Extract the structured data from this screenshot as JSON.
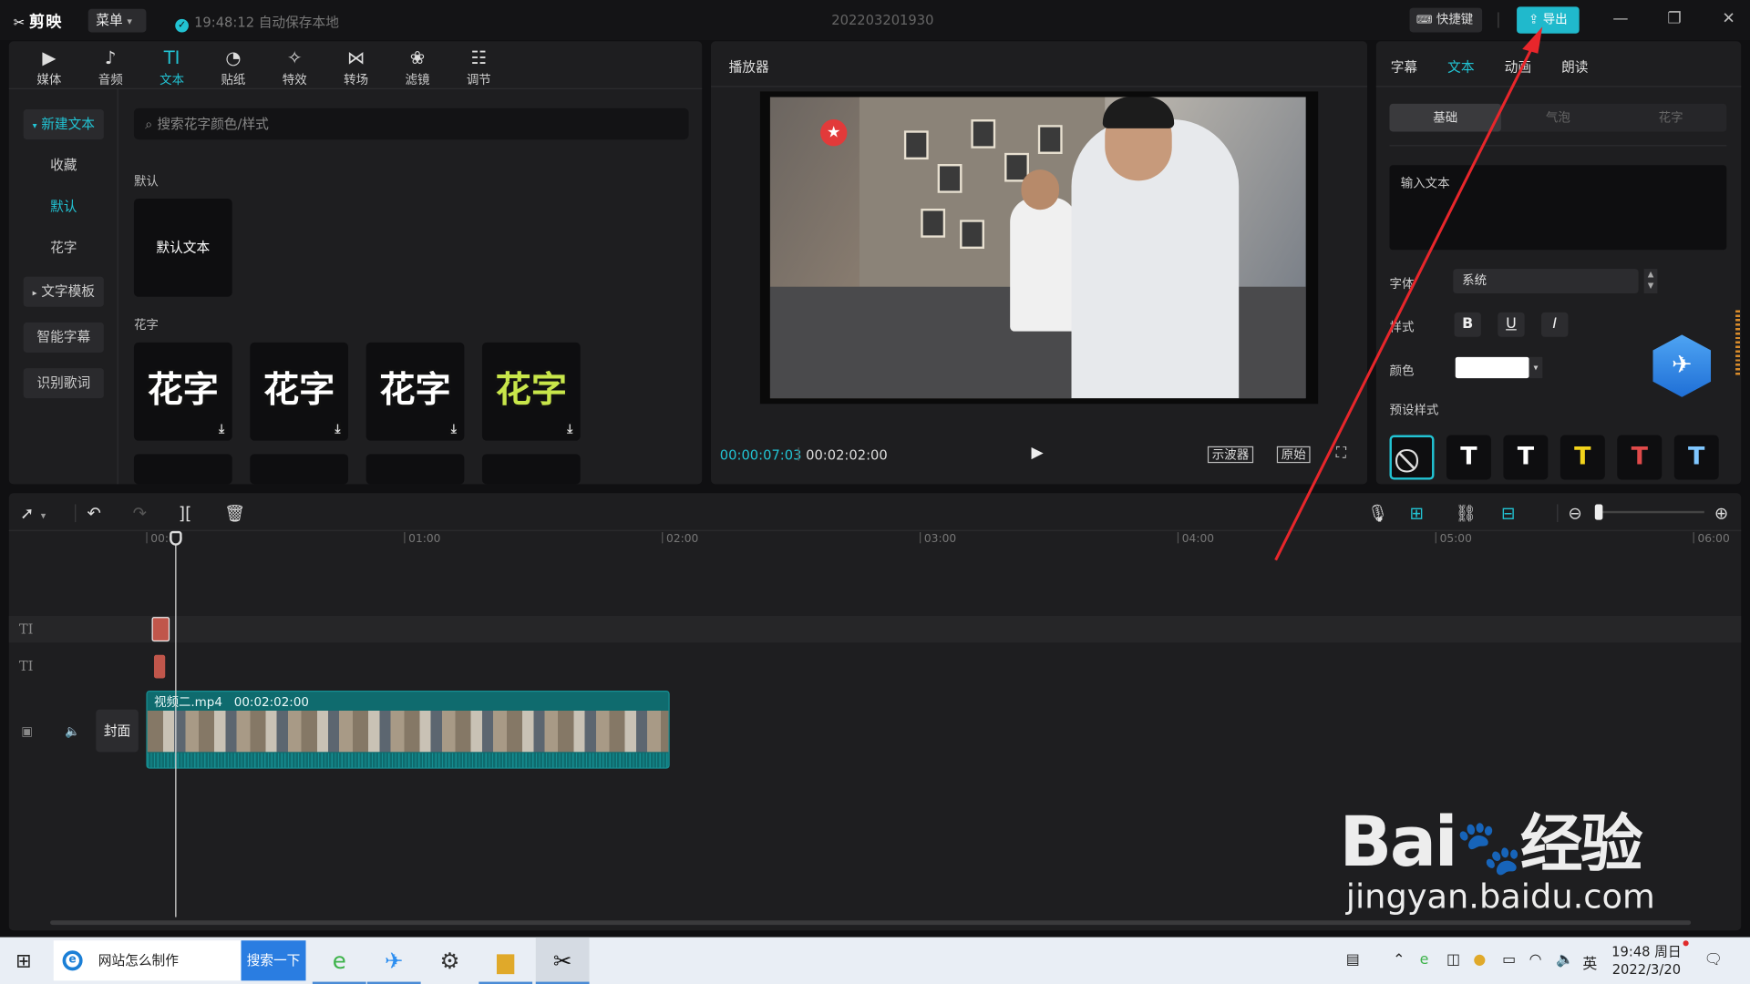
{
  "titlebar": {
    "app_name": "剪映",
    "menu_label": "菜单",
    "save_status": "19:48:12 自动保存本地",
    "project_name": "202203201930",
    "shortcut_label": "快捷键",
    "export_label": "导出"
  },
  "toolbar": {
    "tabs": [
      {
        "label": "媒体",
        "icon": "media-icon",
        "glyph": "▶"
      },
      {
        "label": "音频",
        "icon": "audio-icon",
        "glyph": "♪"
      },
      {
        "label": "文本",
        "icon": "text-icon",
        "glyph": "TI"
      },
      {
        "label": "贴纸",
        "icon": "sticker-icon",
        "glyph": "◔"
      },
      {
        "label": "特效",
        "icon": "effects-icon",
        "glyph": "✧"
      },
      {
        "label": "转场",
        "icon": "transition-icon",
        "glyph": "⋈"
      },
      {
        "label": "滤镜",
        "icon": "filter-icon",
        "glyph": "❀"
      },
      {
        "label": "调节",
        "icon": "adjust-icon",
        "glyph": "☷"
      }
    ],
    "active_tab": "文本"
  },
  "sidebar": {
    "items": [
      {
        "label": "新建文本"
      },
      {
        "label": "收藏"
      },
      {
        "label": "默认"
      },
      {
        "label": "花字"
      },
      {
        "label": "文字模板"
      },
      {
        "label": "智能字幕"
      },
      {
        "label": "识别歌词"
      }
    ]
  },
  "text_library": {
    "search_placeholder": "搜索花字颜色/样式",
    "default_section": "默认",
    "default_card": "默认文本",
    "fancy_section": "花字",
    "fancy_cards": [
      {
        "text": "花字",
        "color": "#ffffff"
      },
      {
        "text": "花字",
        "color": "#ffffff"
      },
      {
        "text": "花字",
        "color": "#ffffff"
      },
      {
        "text": "花字",
        "color": "#c8e64a"
      }
    ]
  },
  "player": {
    "title": "播放器",
    "current_time": "00:00:07:03",
    "total_time": "00:02:02:00",
    "btn_scope": "示波器",
    "btn_original": "原始"
  },
  "inspector": {
    "tabs": [
      "字幕",
      "文本",
      "动画",
      "朗读"
    ],
    "active_tab": "文本",
    "segments": [
      "基础",
      "气泡",
      "花字"
    ],
    "active_segment": "基础",
    "text_value": "输入文本",
    "font_label": "字体",
    "font_value": "系统",
    "style_label": "样式",
    "style_buttons": [
      "B",
      "U",
      "I"
    ],
    "color_label": "颜色",
    "color_value": "#ffffff",
    "preset_label": "预设样式",
    "presets": [
      {
        "glyph": "⃠",
        "color": "#dddddd"
      },
      {
        "glyph": "T",
        "color": "#ffffff"
      },
      {
        "glyph": "T",
        "color": "#ffffff"
      },
      {
        "glyph": "T",
        "color": "#f2d31b"
      },
      {
        "glyph": "T",
        "color": "#e04a4a"
      },
      {
        "glyph": "T",
        "color": "#7fc6ff"
      }
    ]
  },
  "timeline": {
    "ruler": [
      "00:00",
      "01:00",
      "02:00",
      "03:00",
      "04:00",
      "05:00",
      "06:00"
    ],
    "video_clip": {
      "name": "视频二.mp4",
      "duration": "00:02:02:00"
    },
    "cover_label": "封面",
    "text_track_label": "TI"
  },
  "taskbar": {
    "search_text": "网站怎么制作",
    "search_btn": "搜索一下",
    "apps": [
      "browser-icon",
      "feishu-icon",
      "settings-icon",
      "explorer-icon",
      "capcut-icon"
    ],
    "ime": "英",
    "time": "19:48 周日",
    "date": "2022/3/20"
  },
  "watermark": {
    "logo": "Bai",
    "logo_suffix": "经验",
    "url": "jingyan.baidu.com"
  }
}
